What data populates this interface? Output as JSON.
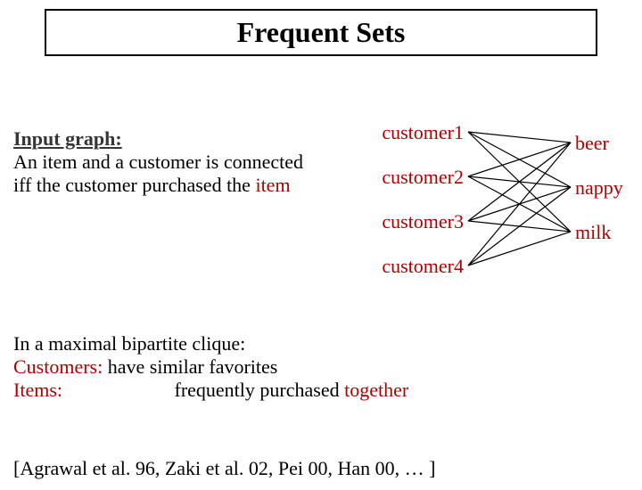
{
  "title": "Frequent Sets",
  "input": {
    "heading": "Input graph:",
    "line1": "An item and a customer is connected",
    "line2_prefix": " iff the customer purchased the ",
    "line2_item": "item"
  },
  "graph": {
    "customers": [
      "customer1",
      "customer2",
      "customer3",
      "customer4"
    ],
    "items": [
      "beer",
      "nappy",
      "milk"
    ],
    "edges": [
      [
        0,
        0
      ],
      [
        0,
        1
      ],
      [
        0,
        2
      ],
      [
        1,
        0
      ],
      [
        1,
        1
      ],
      [
        1,
        2
      ],
      [
        2,
        0
      ],
      [
        2,
        1
      ],
      [
        2,
        2
      ],
      [
        3,
        0
      ],
      [
        3,
        1
      ],
      [
        3,
        2
      ]
    ]
  },
  "body": {
    "line1": "In a maximal bipartite clique:",
    "customers_label": "Customers: ",
    "customers_desc": " have similar favorites",
    "items_label": "Items: ",
    "items_desc_prefix": "frequently purchased ",
    "items_desc_together": "together"
  },
  "citation": "[Agrawal et al. 96, Zaki et al. 02, Pei 00, Han 00, … ]"
}
